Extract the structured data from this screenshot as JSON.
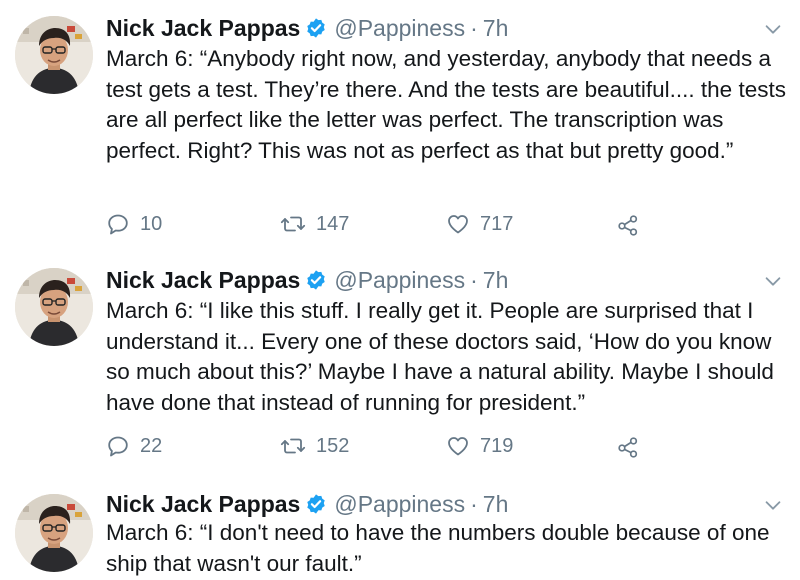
{
  "tweets": [
    {
      "name": "Nick Jack Pappas",
      "handle": "@Pappiness",
      "separator": "·",
      "time": "7h",
      "text": "March 6: “Anybody right now, and yesterday, anybody that needs a test gets a test. They’re there. And the tests are beautiful.... the tests are all perfect like the letter was perfect. The transcription was perfect. Right? This was not as perfect as that but pretty good.”",
      "replies": "10",
      "retweets": "147",
      "likes": "717"
    },
    {
      "name": "Nick Jack Pappas",
      "handle": "@Pappiness",
      "separator": "·",
      "time": "7h",
      "text": "March 6: “I like this stuff. I really get it. People are surprised that I understand it... Every one of these doctors said, ‘How do you know so much about this?’ Maybe I have a natural ability. Maybe I should have done that instead of running for president.”",
      "replies": "22",
      "retweets": "152",
      "likes": "719"
    },
    {
      "name": "Nick Jack Pappas",
      "handle": "@Pappiness",
      "separator": "·",
      "time": "7h",
      "text": "March 6: “I don't need to have the numbers double because of one ship that wasn't our fault.”"
    }
  ],
  "icons": {
    "verified": "verified-badge-icon",
    "caret": "chevron-down-icon",
    "reply": "reply-icon",
    "retweet": "retweet-icon",
    "like": "heart-icon",
    "share": "share-icon"
  },
  "colors": {
    "text": "#14171a",
    "secondary": "#657786",
    "verified": "#1da1f2"
  }
}
